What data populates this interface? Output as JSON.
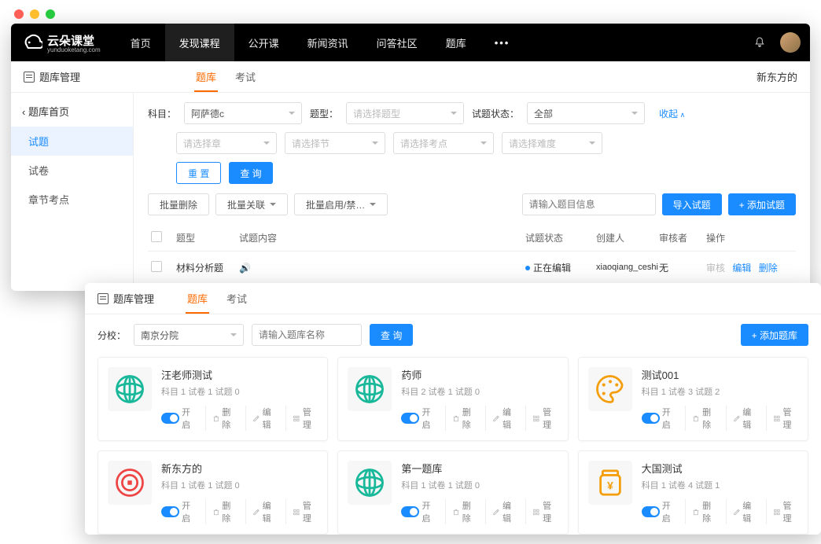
{
  "mac_dots": true,
  "window1": {
    "logo": {
      "brand": "云朵课堂",
      "domain": "yunduoketang.com"
    },
    "nav": [
      "首页",
      "发现课程",
      "公开课",
      "新闻资讯",
      "问答社区",
      "题库"
    ],
    "nav_active": "发现课程",
    "nav_more": "•••",
    "subheader": {
      "title": "题库管理",
      "tabs": [
        "题库",
        "考试"
      ],
      "active_tab": "题库",
      "right": "新东方的"
    },
    "sidebar": {
      "back": "‹ 题库首页",
      "items": [
        "试题",
        "试卷",
        "章节考点"
      ],
      "active": "试题"
    },
    "filters": {
      "subject_label": "科目：",
      "subject_value": "阿萨德c",
      "type_label": "题型：",
      "type_placeholder": "请选择题型",
      "status_label": "试题状态：",
      "status_value": "全部",
      "collapse": "收起",
      "chapter_placeholder": "请选择章",
      "section_placeholder": "请选择节",
      "point_placeholder": "请选择考点",
      "difficulty_placeholder": "请选择难度",
      "reset": "重 置",
      "query": "查 询"
    },
    "toolbar": {
      "bulk_delete": "批量删除",
      "bulk_link": "批量关联",
      "bulk_enable": "批量启用/禁…",
      "search_placeholder": "请输入题目信息",
      "import": "导入试题",
      "add": "+ 添加试题"
    },
    "table": {
      "headers": {
        "type": "题型",
        "content": "试题内容",
        "status": "试题状态",
        "creator": "创建人",
        "reviewer": "审核者",
        "ops": "操作"
      },
      "row": {
        "type": "材料分析题",
        "audio": true,
        "status": "正在编辑",
        "creator": "xiaoqiang_ceshi",
        "reviewer": "无",
        "op_audit": "审核",
        "op_edit": "编辑",
        "op_delete": "删除"
      }
    }
  },
  "window2": {
    "subheader": {
      "title": "题库管理",
      "tabs": [
        "题库",
        "考试"
      ],
      "active_tab": "题库"
    },
    "filter": {
      "school_label": "分校：",
      "school_value": "南京分院",
      "name_placeholder": "请输入题库名称",
      "query": "查 询",
      "add": "+ 添加题库"
    },
    "card_ops": {
      "open": "开启",
      "delete": "删除",
      "edit": "编辑",
      "manage": "管理"
    },
    "cards": [
      {
        "title": "汪老师测试",
        "meta": "科目 1  试卷 1  试题 0",
        "icon": "globe"
      },
      {
        "title": "药师",
        "meta": "科目 2  试卷 1  试题 0",
        "icon": "globe"
      },
      {
        "title": "测试001",
        "meta": "科目 1  试卷 3  试题 2",
        "icon": "palette"
      },
      {
        "title": "新东方的",
        "meta": "科目 1  试卷 1  试题 0",
        "icon": "coin"
      },
      {
        "title": "第一题库",
        "meta": "科目 1  试卷 1  试题 0",
        "icon": "globe"
      },
      {
        "title": "大国测试",
        "meta": "科目 1  试卷 4  试题 1",
        "icon": "jar"
      }
    ]
  }
}
